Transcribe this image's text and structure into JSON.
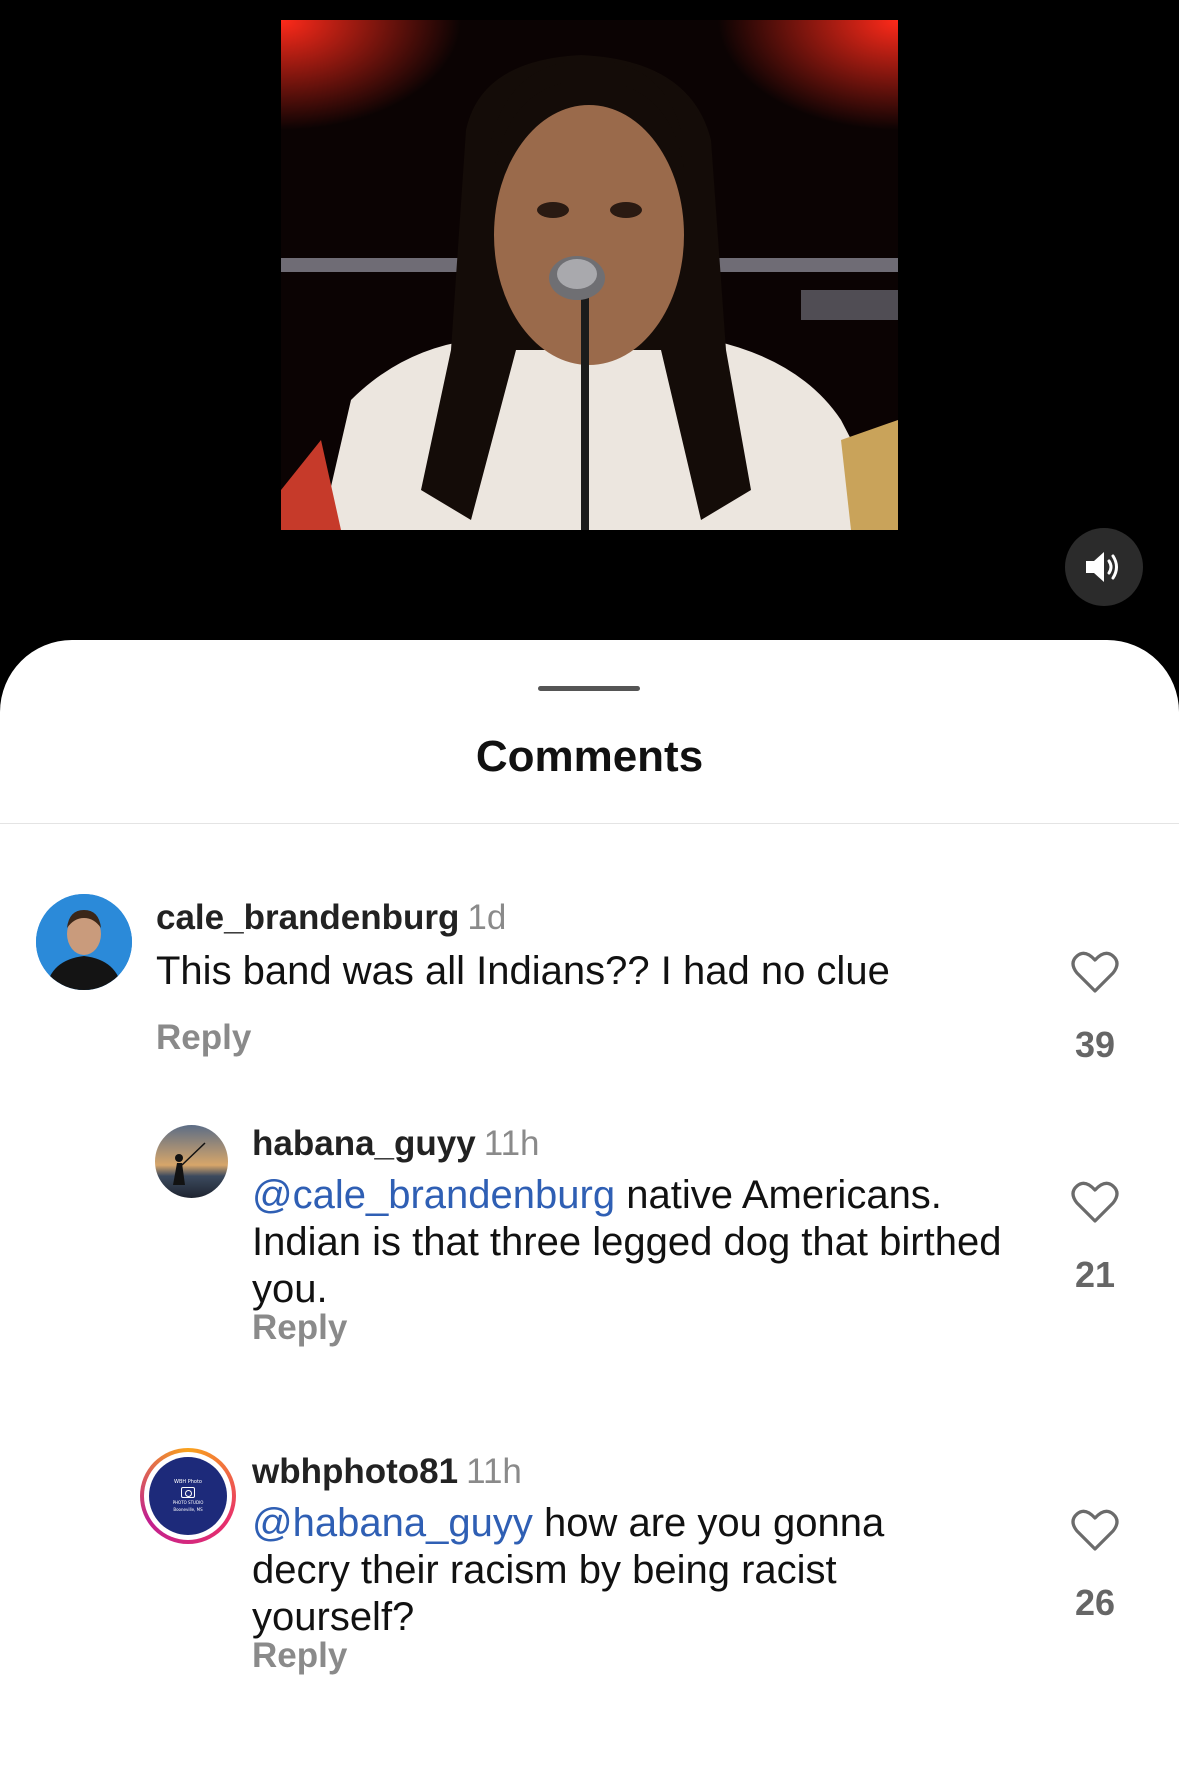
{
  "video": {
    "mute_icon": "speaker-icon"
  },
  "sheet": {
    "title": "Comments"
  },
  "comments": [
    {
      "username": "cale_brandenburg",
      "time": "1d",
      "text": "This band was all Indians?? I had no clue",
      "reply_label": "Reply",
      "likes": "39"
    },
    {
      "username": "habana_guyy",
      "time": "11h",
      "mention": "@cale_brandenburg",
      "text": "native Americans. Indian is that three legged dog that birthed you.",
      "reply_label": "Reply",
      "likes": "21"
    },
    {
      "username": "wbhphoto81",
      "time": "11h",
      "mention": "@habana_guyy",
      "text": "how are you gonna decry their racism by being racist yourself?",
      "reply_label": "Reply",
      "likes": "26",
      "avatar_logo": {
        "line1": "WBH Photo",
        "line2": "PHOTO STUDIO",
        "line3": "Booneville, MS"
      }
    }
  ],
  "colors": {
    "mention": "#2f5fb4",
    "story_ring_start": "#f9a31b",
    "story_ring_end": "#c1208f"
  }
}
